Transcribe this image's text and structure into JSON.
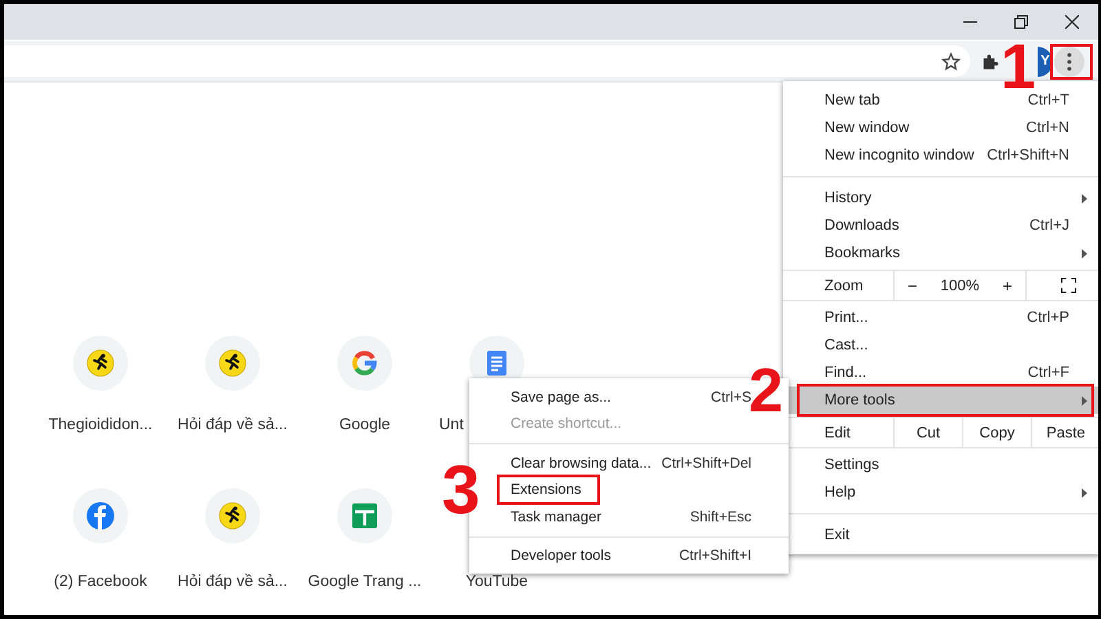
{
  "toolbar": {
    "avatar": "Y",
    "menu_button": {
      "marked": true
    }
  },
  "shortcuts": [
    {
      "label": "Thegioididon...",
      "kind": "runner"
    },
    {
      "label": "Hỏi đáp về sả...",
      "kind": "runner"
    },
    {
      "label": "Google",
      "kind": "ring"
    },
    {
      "label": "Unt",
      "kind": "doc"
    },
    {
      "label": "(2) Facebook",
      "kind": "round"
    },
    {
      "label": "Hỏi đáp về sả...",
      "kind": "runner"
    },
    {
      "label": "Google Trang ...",
      "kind": "sheet"
    },
    {
      "label": "YouTube",
      "kind": "hidden"
    }
  ],
  "menu": {
    "items": [
      {
        "kind": "item",
        "label": "New tab",
        "shortcut": "Ctrl+T"
      },
      {
        "kind": "item",
        "label": "New window",
        "shortcut": "Ctrl+N"
      },
      {
        "kind": "item",
        "label": "New incognito window",
        "shortcut": "Ctrl+Shift+N"
      },
      {
        "kind": "divider"
      },
      {
        "kind": "item",
        "label": "History",
        "submenu": true
      },
      {
        "kind": "item",
        "label": "Downloads",
        "shortcut": "Ctrl+J"
      },
      {
        "kind": "item",
        "label": "Bookmarks",
        "submenu": true
      },
      {
        "kind": "zoom",
        "label": "Zoom",
        "minus": "−",
        "value": "100%",
        "plus": "+"
      },
      {
        "kind": "item",
        "label": "Print...",
        "shortcut": "Ctrl+P"
      },
      {
        "kind": "item",
        "label": "Cast..."
      },
      {
        "kind": "item",
        "label": "Find...",
        "shortcut": "Ctrl+F"
      },
      {
        "kind": "item",
        "label": "More tools",
        "submenu": true,
        "selected": true,
        "marked": true
      },
      {
        "kind": "edit",
        "label": "Edit",
        "cut": "Cut",
        "copy": "Copy",
        "paste": "Paste"
      },
      {
        "kind": "item",
        "label": "Settings"
      },
      {
        "kind": "item",
        "label": "Help",
        "submenu": true
      },
      {
        "kind": "divider"
      },
      {
        "kind": "item",
        "label": "Exit"
      }
    ]
  },
  "submenu": {
    "items": [
      {
        "kind": "item",
        "label": "Save page as...",
        "shortcut": "Ctrl+S"
      },
      {
        "kind": "item",
        "label": "Create shortcut...",
        "disabled": true
      },
      {
        "kind": "divider"
      },
      {
        "kind": "item",
        "label": "Clear browsing data...",
        "shortcut": "Ctrl+Shift+Del"
      },
      {
        "kind": "item",
        "label": "Extensions",
        "marked": true
      },
      {
        "kind": "item",
        "label": "Task manager",
        "shortcut": "Shift+Esc"
      },
      {
        "kind": "divider"
      },
      {
        "kind": "item",
        "label": "Developer tools",
        "shortcut": "Ctrl+Shift+I"
      }
    ]
  },
  "annotations": [
    "1",
    "2",
    "3"
  ]
}
